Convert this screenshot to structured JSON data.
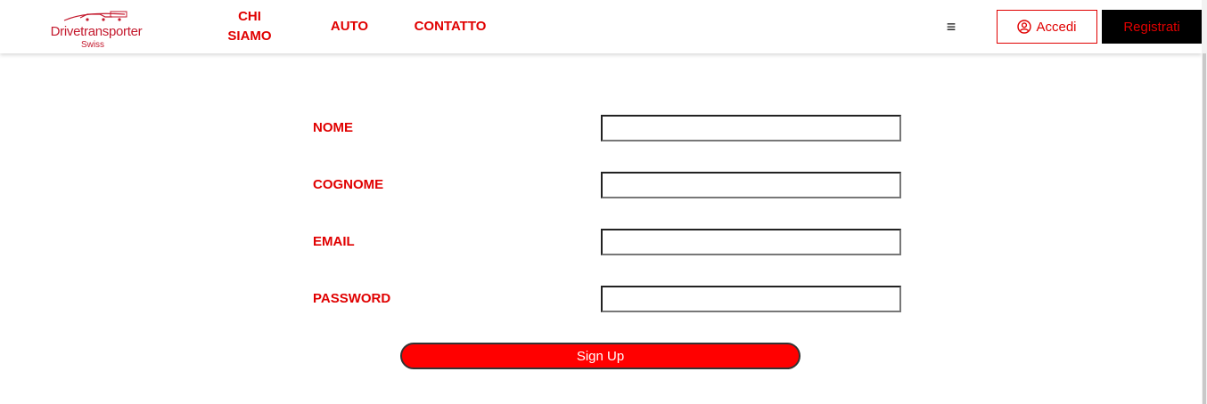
{
  "brand": {
    "name": "Drivetransporter",
    "sub": "Swiss",
    "color": "#c41a2e"
  },
  "nav": {
    "chi_line1": "CHI",
    "chi_line2": "SIAMO",
    "auto": "AUTO",
    "contatto": "CONTATTO",
    "menu_icon": "≡"
  },
  "auth": {
    "accedi": "Accedi",
    "registrati": "Registrati"
  },
  "form": {
    "nome_label": "NOME",
    "nome_value": "",
    "cognome_label": "COGNOME",
    "cognome_value": "",
    "email_label": "EMAIL",
    "email_value": "",
    "password_label": "PASSWORD",
    "password_value": "",
    "submit": "Sign Up"
  },
  "colors": {
    "accent": "#e00000",
    "button_bg": "#ff0000",
    "dark": "#000000"
  }
}
